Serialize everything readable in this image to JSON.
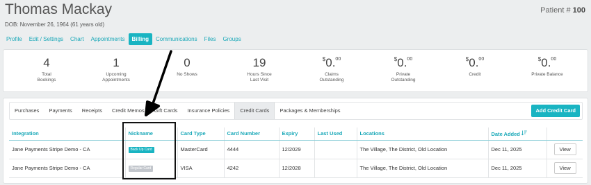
{
  "patient": {
    "name": "Thomas Mackay",
    "dob": "DOB: November 26, 1964 (61 years old)",
    "number_label": "Patient #",
    "number": "100"
  },
  "nav": {
    "items": [
      {
        "label": "Profile"
      },
      {
        "label": "Edit / Settings"
      },
      {
        "label": "Chart"
      },
      {
        "label": "Appointments"
      },
      {
        "label": "Billing",
        "active": true
      },
      {
        "label": "Communications"
      },
      {
        "label": "Files"
      },
      {
        "label": "Groups"
      }
    ]
  },
  "stats": [
    {
      "value": "4",
      "label1": "Total",
      "label2": "Bookings"
    },
    {
      "value": "1",
      "label1": "Upcoming",
      "label2": "Appointments"
    },
    {
      "value": "0",
      "label1": "No Shows",
      "label2": ""
    },
    {
      "value": "19",
      "label1": "Hours Since",
      "label2": "Last Visit"
    },
    {
      "currency": "$",
      "value": "0.",
      "cents": "00",
      "label1": "Claims",
      "label2": "Outstanding"
    },
    {
      "currency": "$",
      "value": "0.",
      "cents": "00",
      "label1": "Private",
      "label2": "Outstanding"
    },
    {
      "currency": "$",
      "value": "0.",
      "cents": "00",
      "label1": "Credit",
      "label2": ""
    },
    {
      "currency": "$",
      "value": "0.",
      "cents": "00",
      "label1": "Private Balance",
      "label2": ""
    }
  ],
  "subtabs": {
    "items": [
      {
        "label": "Purchases"
      },
      {
        "label": "Payments"
      },
      {
        "label": "Receipts"
      },
      {
        "label": "Credit Memos"
      },
      {
        "label": "Gift Cards"
      },
      {
        "label": "Insurance Policies"
      },
      {
        "label": "Credit Cards",
        "active": true
      },
      {
        "label": "Packages & Memberships"
      }
    ],
    "add_button": "Add Credit Card"
  },
  "table": {
    "headers": [
      "Integration",
      "Nickname",
      "Card Type",
      "Card Number",
      "Expiry",
      "Last Used",
      "Locations",
      "Date Added",
      ""
    ],
    "rows": [
      {
        "integration": "Jane Payments Stripe Demo - CA",
        "nickname": "Back Up Card",
        "nickname_color": "#19b4c2",
        "card_type": "MasterCard",
        "card_number": "4444",
        "expiry": "12/2029",
        "last_used": "",
        "locations": "The Village, The District, Old Location",
        "date_added": "Dec 11, 2025",
        "action": "View"
      },
      {
        "integration": "Jane Payments Stripe Demo - CA",
        "nickname": "Regular Card",
        "nickname_color": "#c2c6cc",
        "card_type": "VISA",
        "card_number": "4242",
        "expiry": "12/2028",
        "last_used": "",
        "locations": "The Village, The District, Old Location",
        "date_added": "Dec 11, 2025",
        "action": "View"
      }
    ]
  },
  "colors": {
    "accent": "#19b4c2",
    "link": "#19a8b8"
  }
}
